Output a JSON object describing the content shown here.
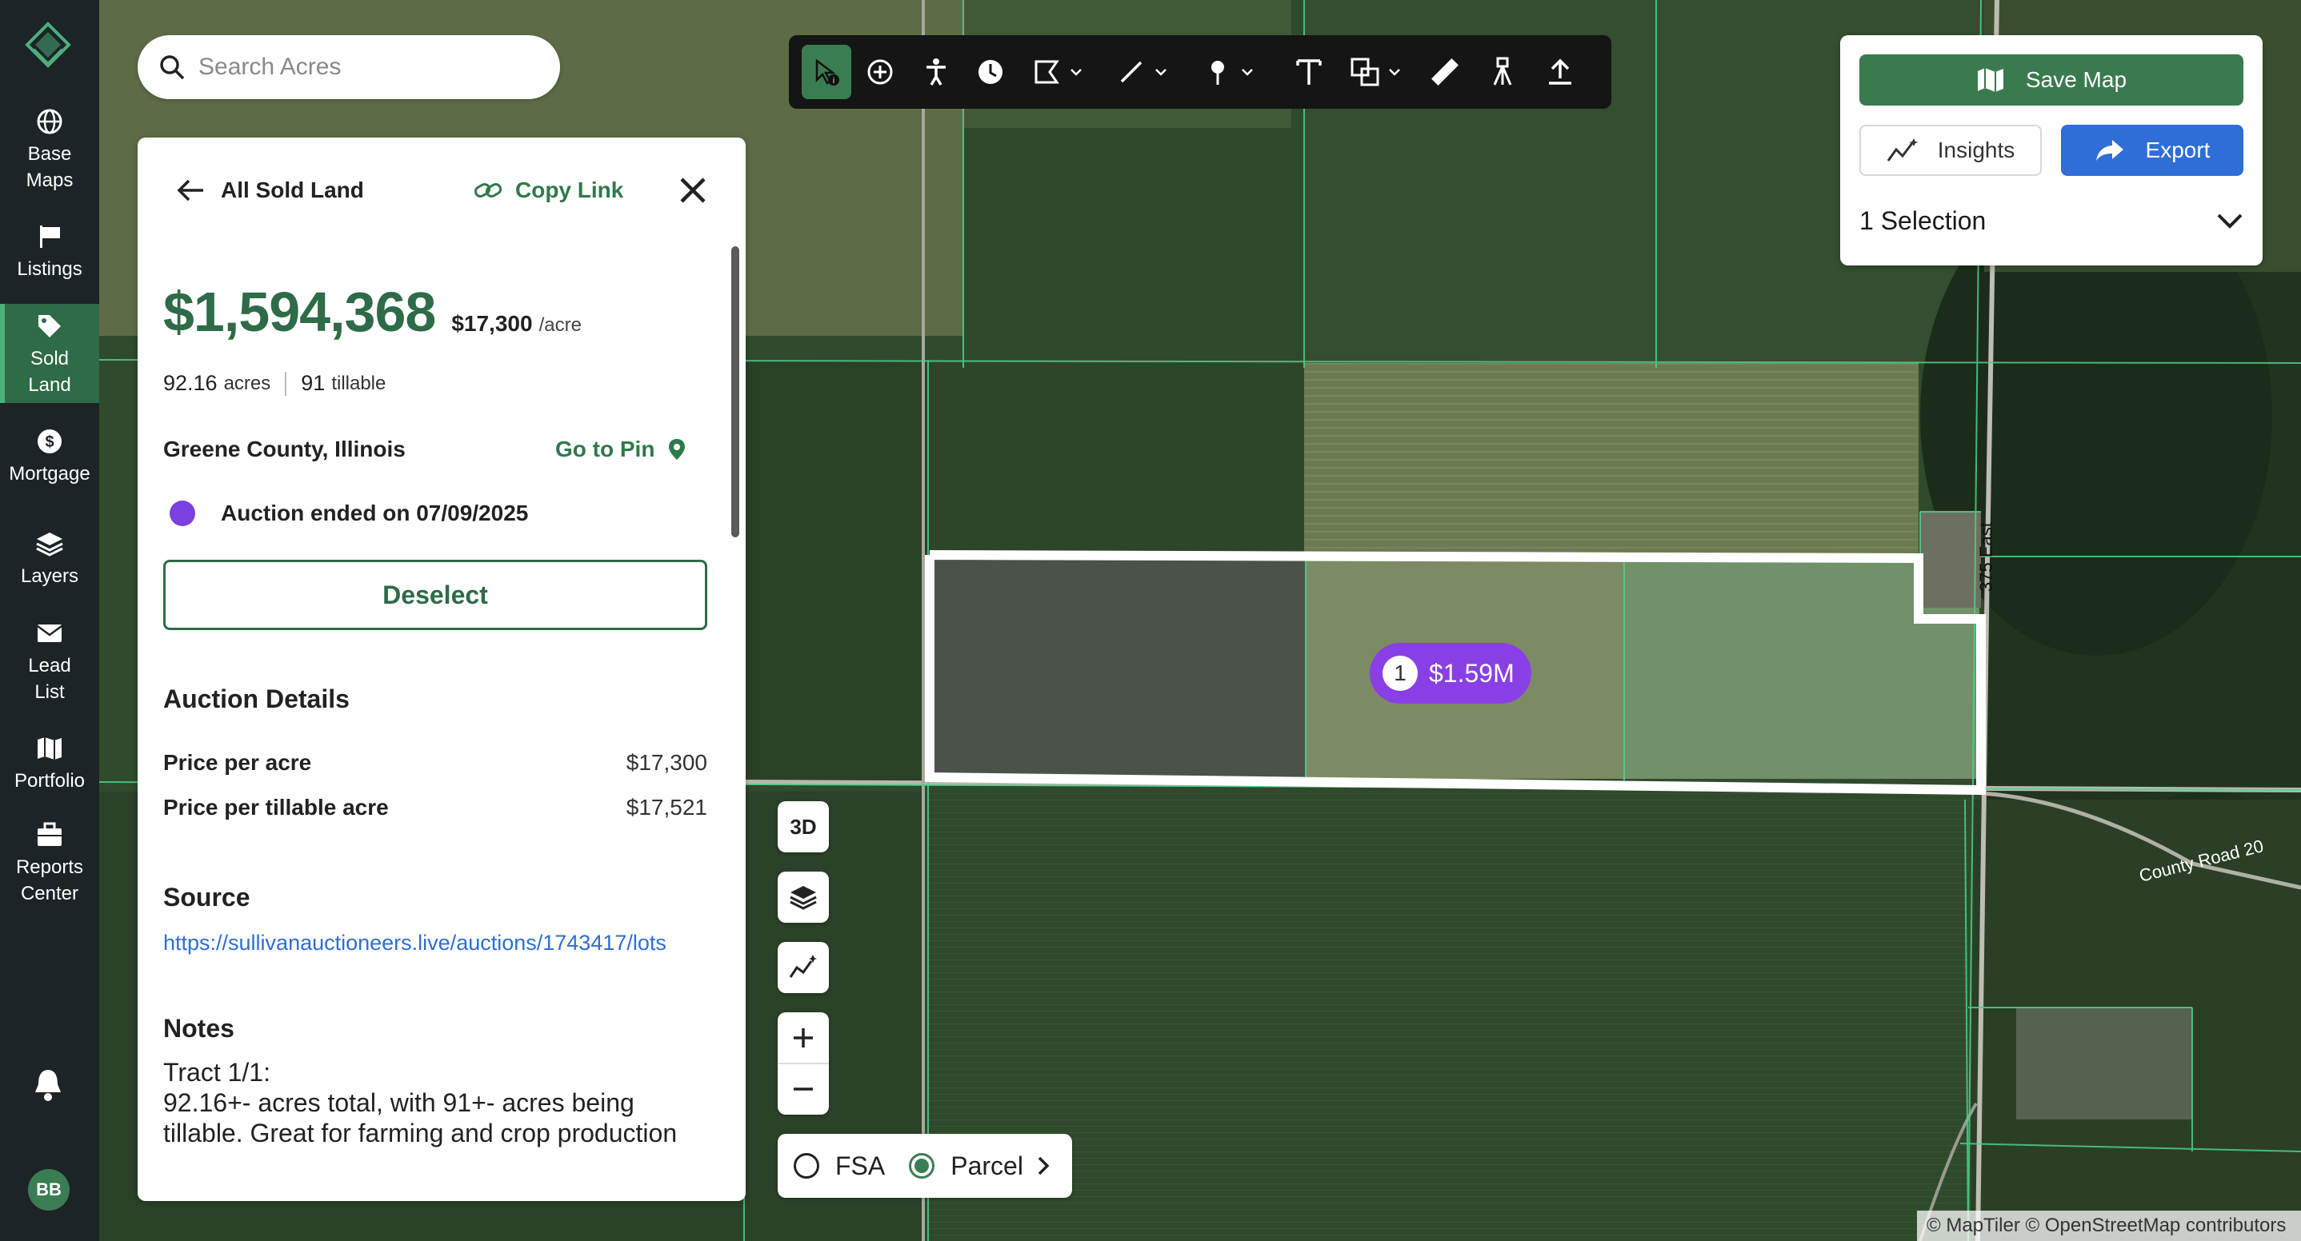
{
  "nav": {
    "items": [
      {
        "label_1": "Base",
        "label_2": "Maps",
        "icon": "globe-icon"
      },
      {
        "label_1": "Listings",
        "label_2": "",
        "icon": "flag-icon"
      },
      {
        "label_1": "Sold",
        "label_2": "Land",
        "icon": "tag-icon"
      },
      {
        "label_1": "Mortgage",
        "label_2": "",
        "icon": "dollar-icon"
      },
      {
        "label_1": "Layers",
        "label_2": "",
        "icon": "layers-icon"
      },
      {
        "label_1": "Lead",
        "label_2": "List",
        "icon": "mail-icon"
      },
      {
        "label_1": "Portfolio",
        "label_2": "",
        "icon": "map-icon"
      },
      {
        "label_1": "Reports",
        "label_2": "Center",
        "icon": "briefcase-icon"
      }
    ],
    "active": "Sold Land",
    "avatar": "BB"
  },
  "search": {
    "placeholder": "Search Acres"
  },
  "toolbar": {
    "tools": [
      "select-info",
      "add-point",
      "person",
      "history",
      "polygon",
      "line",
      "pin",
      "text",
      "shapes",
      "ruler",
      "survey",
      "upload"
    ]
  },
  "right_panel": {
    "save_map": "Save Map",
    "insights": "Insights",
    "export": "Export",
    "selection": "1 Selection"
  },
  "detail": {
    "back_label": "All Sold Land",
    "copy_link": "Copy Link",
    "price": "$1,594,368",
    "price_per_acre": "$17,300",
    "per_acre_unit": "/acre",
    "acres_value": "92.16",
    "acres_unit": "acres",
    "tillable_value": "91",
    "tillable_unit": "tillable",
    "county": "Greene County, Illinois",
    "go_to_pin": "Go to Pin",
    "auction_status": "Auction ended on 07/09/2025",
    "deselect": "Deselect",
    "auction_details_title": "Auction Details",
    "rows": [
      {
        "label": "Price per acre",
        "value": "$17,300"
      },
      {
        "label": "Price per tillable acre",
        "value": "$17,521"
      }
    ],
    "source_title": "Source",
    "source_url": "https://sullivanauctioneers.live/auctions/1743417/lots",
    "notes_title": "Notes",
    "notes_line1": "Tract 1/1:",
    "notes_line2": "92.16+- acres total, with 91+- acres being",
    "notes_line3": "tillable. Great for farming and crop production"
  },
  "map": {
    "controls": {
      "three_d": "3D"
    },
    "layer_toggle": {
      "fsa": "FSA",
      "parcel": "Parcel",
      "selected": "Parcel"
    },
    "badge": {
      "index": "1",
      "price": "$1.59M"
    },
    "road_labels": {
      "east": "375 East",
      "county_road": "County Road 20"
    },
    "attribution": "© MapTiler © OpenStreetMap contributors",
    "colors": {
      "parcel_line": "#4fd18c",
      "selection_outline": "#ffffff",
      "badge": "#8a3fe6"
    }
  },
  "colors": {
    "brand_green": "#2e6b47",
    "accent_blue": "#2f6ed6",
    "nav_bg": "#1c2427"
  }
}
